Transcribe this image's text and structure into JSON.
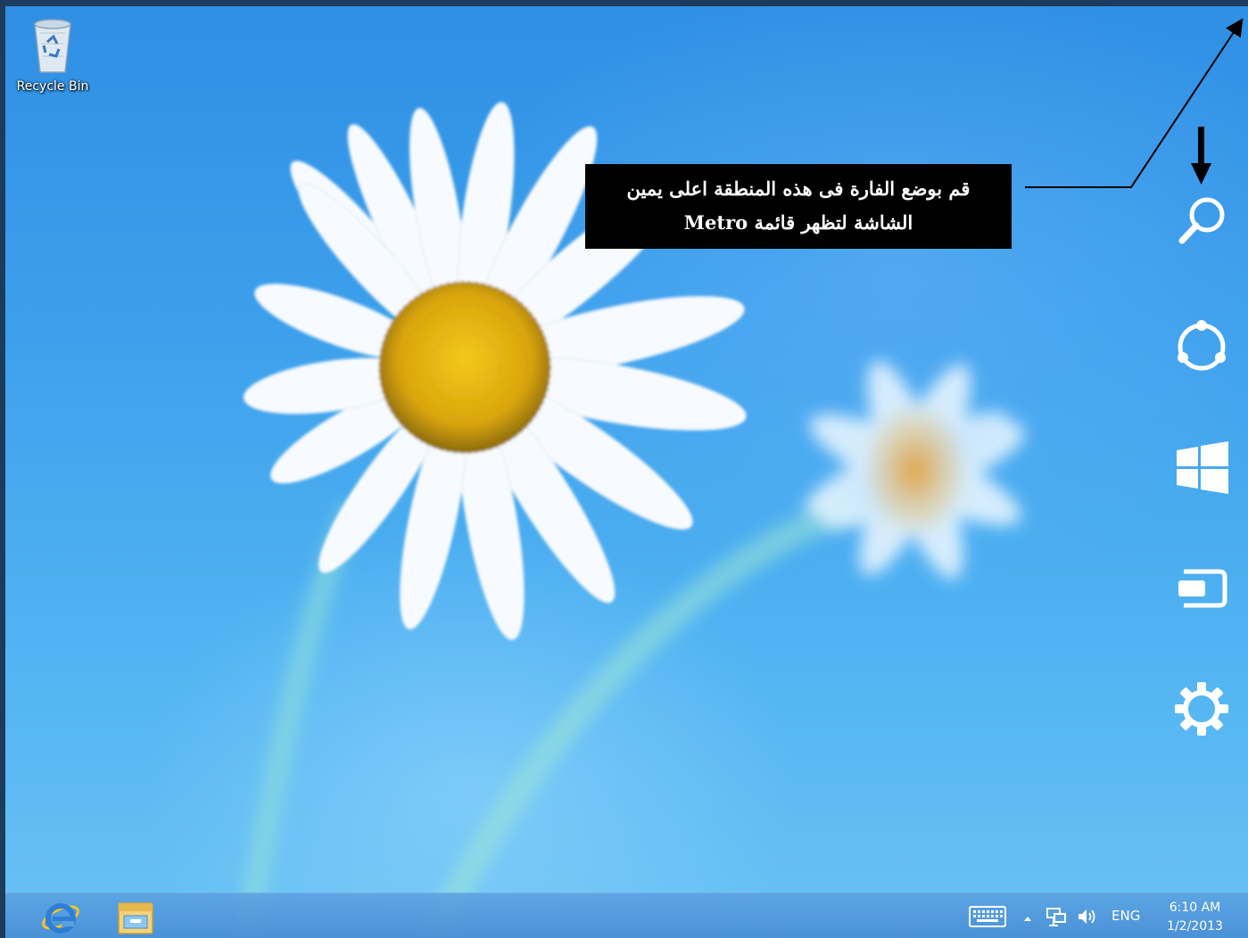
{
  "desktop": {
    "icons": [
      {
        "label": "Recycle Bin",
        "icon": "recycle-bin-icon"
      }
    ]
  },
  "annotation": {
    "line1": "قم بوضع الفارة فى هذه المنطقة اعلى يمين",
    "line2": "الشاشة لتظهر قائمة Metro"
  },
  "charms": [
    {
      "name": "search",
      "icon": "search-icon"
    },
    {
      "name": "share",
      "icon": "share-icon"
    },
    {
      "name": "start",
      "icon": "windows-logo-icon"
    },
    {
      "name": "devices",
      "icon": "devices-icon"
    },
    {
      "name": "settings",
      "icon": "gear-icon"
    }
  ],
  "taskbar": {
    "pinned": [
      {
        "name": "internet-explorer",
        "icon": "internet-explorer-icon"
      },
      {
        "name": "file-explorer",
        "icon": "folder-icon"
      }
    ],
    "tray": {
      "keyboard_icon": "keyboard-icon",
      "show_hidden_icon": "chevron-up-icon",
      "network_icon": "network-icon",
      "volume_icon": "speaker-icon",
      "language": "ENG",
      "time": "6:10 AM",
      "date": "1/2/2013"
    }
  },
  "colors": {
    "wallpaper_top": "#2f8fe4",
    "wallpaper_bottom": "#6ac2f4",
    "taskbar": "#5aa0e1",
    "callout_background": "#000000",
    "callout_text": "#ffffff"
  }
}
